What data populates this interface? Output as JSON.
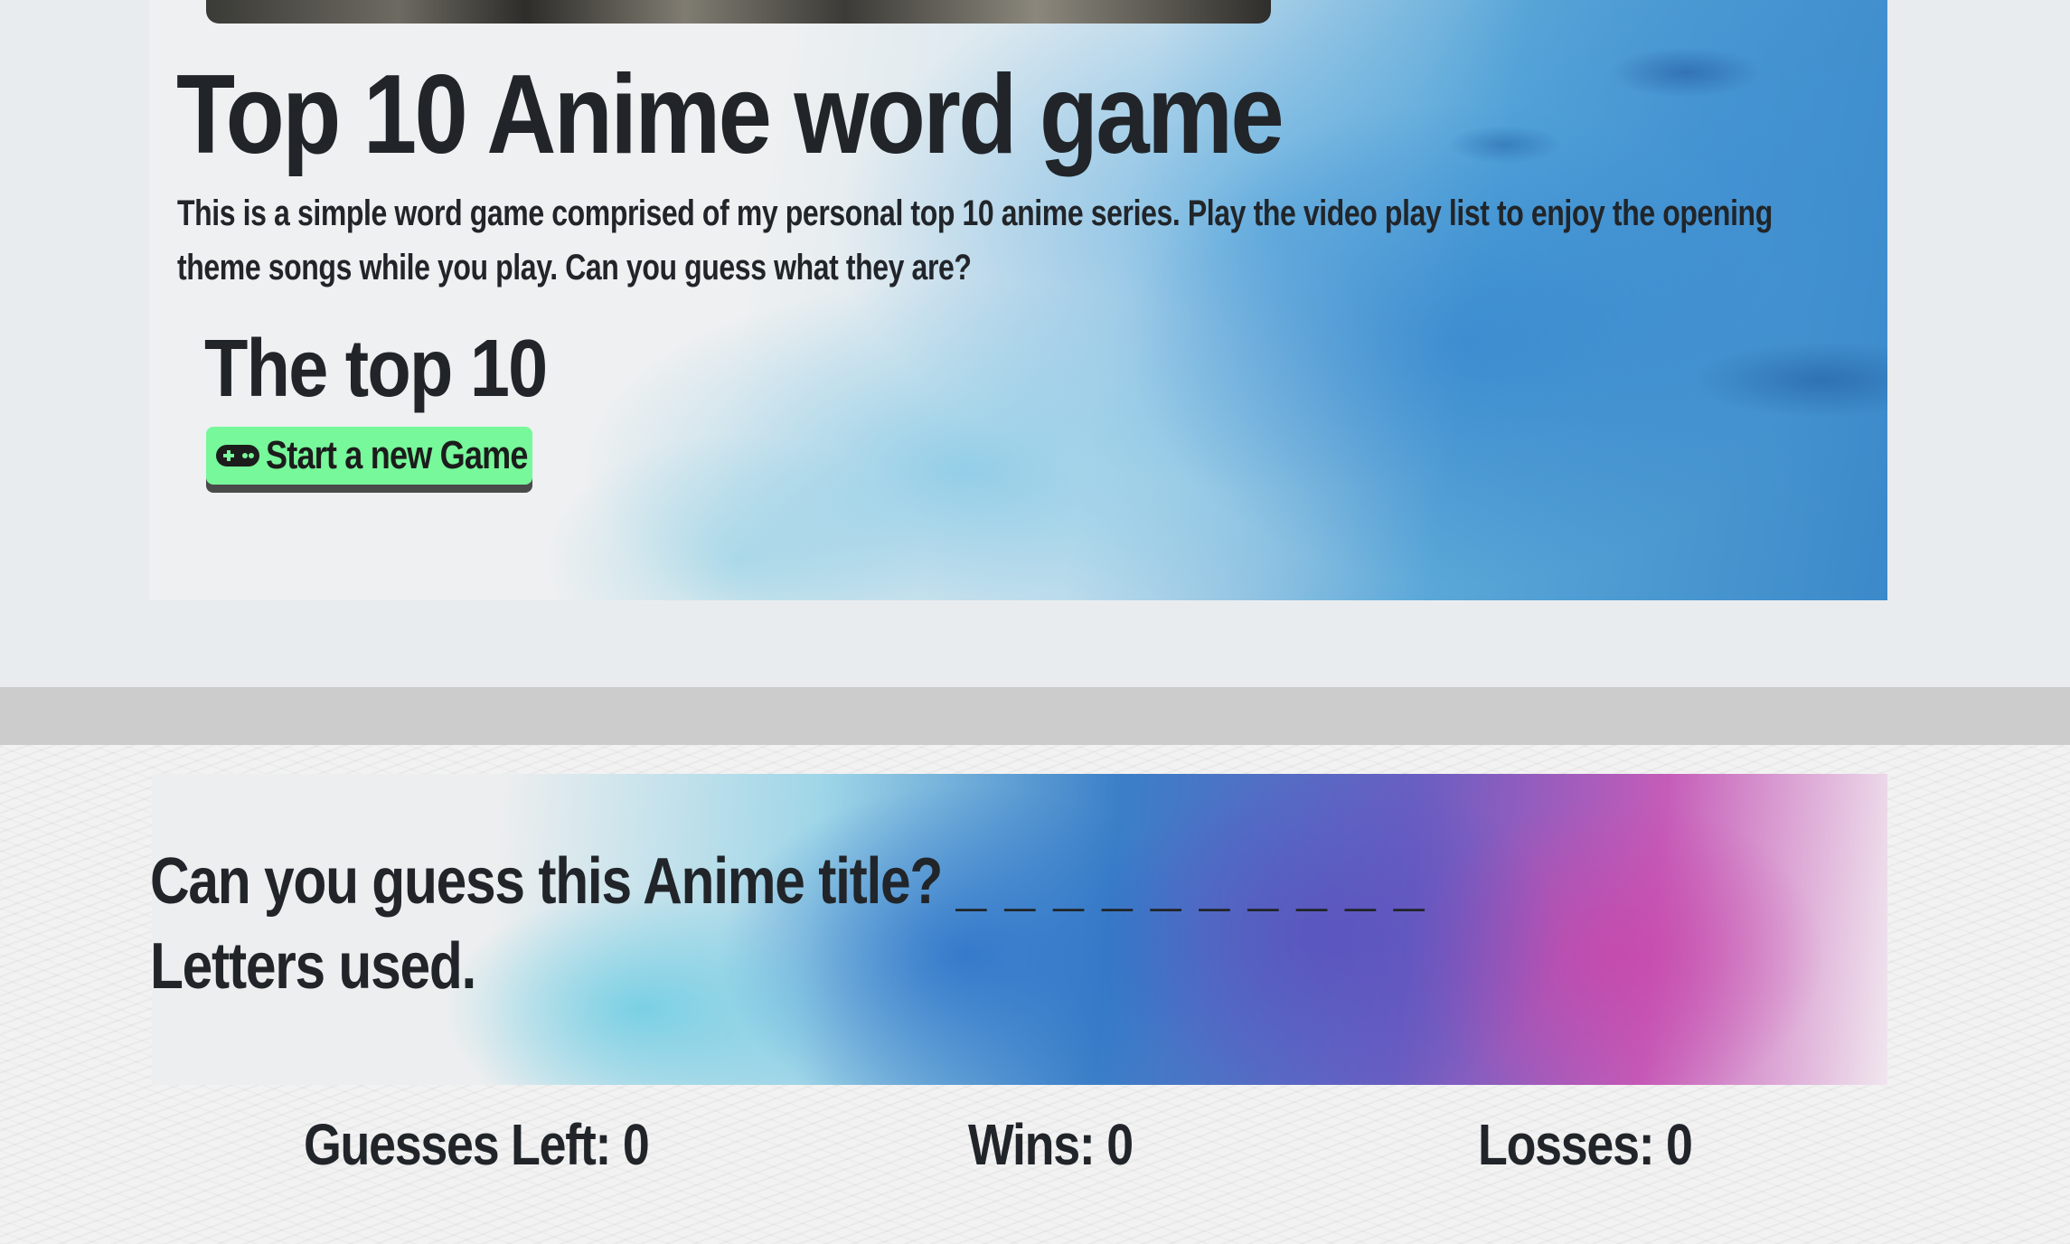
{
  "hero": {
    "title": "Top 10 Anime word game",
    "intro": "This is a simple word game comprised of my personal top 10 anime series. Play the video play list to enjoy the opening theme songs while you play. Can you guess what they are?",
    "subtitle": "The top 10",
    "start_button_label": "Start a new Game",
    "start_button_icon": "gamepad-icon"
  },
  "game": {
    "prompt": "Can you guess this Anime title?",
    "blanks": "_ _ _ _ _   _ _   _ _ _",
    "letters_used_label": "Letters used."
  },
  "stats": {
    "guesses_left": "Guesses Left: 0",
    "wins": "Wins: 0",
    "losses": "Losses: 0"
  },
  "colors": {
    "button_bg": "#77f89a",
    "text": "#212529",
    "band": "#cccccc"
  }
}
